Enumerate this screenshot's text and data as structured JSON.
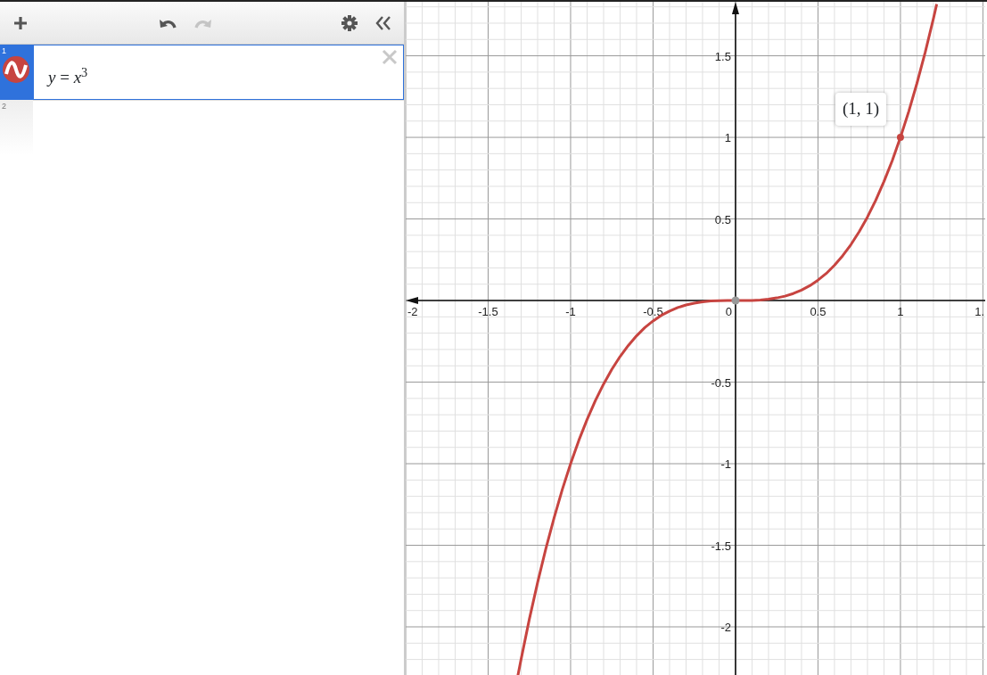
{
  "toolbar": {
    "items": [
      {
        "kind": "add",
        "disabled": false
      },
      {
        "kind": "undo",
        "disabled": false
      },
      {
        "kind": "redo",
        "disabled": true
      },
      {
        "kind": "settings",
        "disabled": false
      },
      {
        "kind": "collapse",
        "disabled": false
      }
    ]
  },
  "expressions": [
    {
      "index": "1",
      "formula": "*y* = *x*$^{3}$",
      "selected": true,
      "color": "#c74440"
    },
    {
      "index": "2",
      "selected": false
    }
  ],
  "graph": {
    "chart_data": {
      "type": "line",
      "grid": true,
      "xlim": [
        -2.0,
        1.514
      ],
      "ylim": [
        -2.306,
        1.831
      ],
      "xticks": [
        {
          "value": -2,
          "label": "-2"
        },
        {
          "value": -1.5,
          "label": "-1.5"
        },
        {
          "value": -1,
          "label": "-1"
        },
        {
          "value": -0.5,
          "label": "-0.5"
        },
        {
          "value": 0,
          "label": "0"
        },
        {
          "value": 0.5,
          "label": "0.5"
        },
        {
          "value": 1,
          "label": "1"
        },
        {
          "value": 1.5,
          "label": "1."
        }
      ],
      "yticks": [
        {
          "value": 1.5,
          "label": "1.5"
        },
        {
          "value": 1,
          "label": "1"
        },
        {
          "value": 0.5,
          "label": "0.5"
        },
        {
          "value": -0.5,
          "label": "-0.5"
        },
        {
          "value": -1,
          "label": "-1"
        },
        {
          "value": -1.5,
          "label": "-1.5"
        },
        {
          "value": -2,
          "label": "-2"
        }
      ],
      "x": [
        -1.32,
        -1.3,
        -1.25,
        -1.2,
        -1.15,
        -1.1,
        -1.05,
        -1,
        -0.95,
        -0.9,
        -0.85,
        -0.8,
        -0.75,
        -0.7,
        -0.65,
        -0.6,
        -0.55,
        -0.5,
        -0.45,
        -0.4,
        -0.35,
        -0.3,
        -0.25,
        -0.2,
        -0.15,
        -0.1,
        -0.05,
        0,
        0.05,
        0.1,
        0.15,
        0.2,
        0.25,
        0.3,
        0.35,
        0.4,
        0.45,
        0.5,
        0.55,
        0.6,
        0.65,
        0.7,
        0.75,
        0.8,
        0.85,
        0.9,
        0.95,
        1,
        1.05,
        1.1,
        1.15,
        1.2,
        1.22
      ],
      "series": [
        {
          "color": "#c74440",
          "values": [
            -2.3,
            -2.197,
            -1.953,
            -1.728,
            -1.521,
            -1.331,
            -1.158,
            -1,
            -0.857,
            -0.729,
            -0.614,
            -0.512,
            -0.422,
            -0.343,
            -0.275,
            -0.216,
            -0.166,
            -0.125,
            -0.091,
            -0.064,
            -0.043,
            -0.027,
            -0.016,
            -0.008,
            -0.003,
            -0.001,
            0,
            0,
            0,
            0.001,
            0.003,
            0.008,
            0.016,
            0.027,
            0.043,
            0.064,
            0.091,
            0.125,
            0.166,
            0.216,
            0.275,
            0.343,
            0.422,
            0.512,
            0.614,
            0.729,
            0.857,
            1,
            1.158,
            1.331,
            1.521,
            1.728,
            1.816
          ]
        }
      ],
      "annotations": [
        {
          "x": 1,
          "y": 1,
          "text": "(1, 1)"
        }
      ]
    }
  }
}
